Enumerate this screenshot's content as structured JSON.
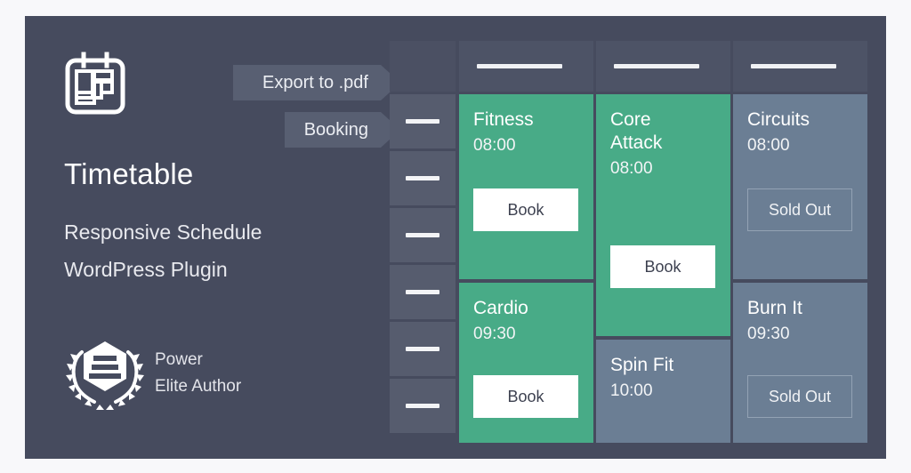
{
  "panel": {
    "background_color": "#464b5e"
  },
  "promo": {
    "icon": "calendar-timetable-icon",
    "title": "Timetable",
    "subtitle_line1": "Responsive Schedule",
    "subtitle_line2": "WordPress Plugin",
    "badge": {
      "icon": "laurel-wreath-award-icon",
      "line1": "Power",
      "line2": "Elite Author"
    }
  },
  "ribbons": [
    {
      "label": "Export to .pdf",
      "name": "ribbon-export-to-pdf"
    },
    {
      "label": "Booking",
      "name": "ribbon-booking"
    }
  ],
  "colors": {
    "panel": "#464b5e",
    "accent_green": "#48ab87",
    "muted_blue": "#6b7e94",
    "ribbon": "#585f72",
    "slot_cell": "#565c6e",
    "header_cell": "#4d5366"
  },
  "timetable": {
    "header_placeholder_dashes": 3,
    "time_slots": [
      "—",
      "—",
      "—",
      "—",
      "—",
      "—"
    ],
    "columns": [
      {
        "name": "column-1",
        "events": [
          {
            "title": "Fitness",
            "time": "08:00",
            "status": "available",
            "action_label": "Book"
          },
          {
            "title": "Cardio",
            "time": "09:30",
            "status": "available",
            "action_label": "Book"
          }
        ]
      },
      {
        "name": "column-2",
        "events": [
          {
            "title": "Core Attack",
            "title_line1": "Core",
            "title_line2": "Attack",
            "time": "08:00",
            "status": "available",
            "action_label": "Book"
          },
          {
            "title": "Spin Fit",
            "time": "10:00",
            "status": "none",
            "action_label": ""
          }
        ]
      },
      {
        "name": "column-3",
        "events": [
          {
            "title": "Circuits",
            "time": "08:00",
            "status": "sold-out",
            "action_label": "Sold Out"
          },
          {
            "title": "Burn It",
            "time": "09:30",
            "status": "sold-out",
            "action_label": "Sold Out"
          }
        ]
      }
    ]
  }
}
